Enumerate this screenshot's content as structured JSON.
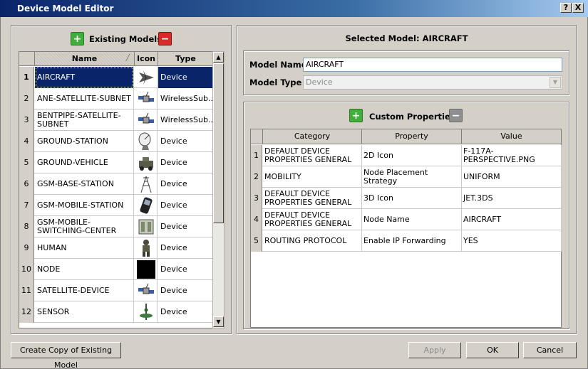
{
  "window": {
    "title": "Device Model Editor",
    "help_button": "?",
    "close_button": "X"
  },
  "left_panel": {
    "title": "Existing Models",
    "columns": [
      "Name",
      "Icon",
      "Type"
    ],
    "rows": [
      {
        "num": "1",
        "name": "AIRCRAFT",
        "icon": "jet-icon",
        "type": "Device",
        "selected": true
      },
      {
        "num": "2",
        "name": "ANE-SATELLITE-SUBNET",
        "icon": "satellite-icon",
        "type": "WirelessSub..."
      },
      {
        "num": "3",
        "name": "BENTPIPE-SATELLITE-SUBNET",
        "icon": "satellite-icon",
        "type": "WirelessSub..."
      },
      {
        "num": "4",
        "name": "GROUND-STATION",
        "icon": "dish-icon",
        "type": "Device"
      },
      {
        "num": "5",
        "name": "GROUND-VEHICLE",
        "icon": "vehicle-icon",
        "type": "Device"
      },
      {
        "num": "6",
        "name": "GSM-BASE-STATION",
        "icon": "tower-icon",
        "type": "Device"
      },
      {
        "num": "7",
        "name": "GSM-MOBILE-STATION",
        "icon": "phone-icon",
        "type": "Device"
      },
      {
        "num": "8",
        "name": "GSM-MOBILE-SWITCHING-CENTER",
        "icon": "switch-icon",
        "type": "Device"
      },
      {
        "num": "9",
        "name": "HUMAN",
        "icon": "soldier-icon",
        "type": "Device"
      },
      {
        "num": "10",
        "name": "NODE",
        "icon": "black-box-icon",
        "type": "Device"
      },
      {
        "num": "11",
        "name": "SATELLITE-DEVICE",
        "icon": "satellite-icon",
        "type": "Device"
      },
      {
        "num": "12",
        "name": "SENSOR",
        "icon": "sensor-icon",
        "type": "Device"
      }
    ],
    "copy_button": "Create Copy of Existing Model"
  },
  "right_panel": {
    "title": "Selected Model: AIRCRAFT",
    "model_name_label": "Model Name",
    "model_name_value": "AIRCRAFT",
    "model_type_label": "Model Type",
    "model_type_value": "Device",
    "custom_title": "Custom Properties",
    "columns": [
      "Category",
      "Property",
      "Value"
    ],
    "rows": [
      {
        "num": "1",
        "category": "DEFAULT DEVICE PROPERTIES GENERAL",
        "property": "2D Icon",
        "value": "F-117A-PERSPECTIVE.PNG"
      },
      {
        "num": "2",
        "category": "MOBILITY",
        "property": "Node Placement Strategy",
        "value": "UNIFORM"
      },
      {
        "num": "3",
        "category": "DEFAULT DEVICE PROPERTIES GENERAL",
        "property": "3D Icon",
        "value": "JET.3DS"
      },
      {
        "num": "4",
        "category": "DEFAULT DEVICE PROPERTIES GENERAL",
        "property": "Node Name",
        "value": "AIRCRAFT"
      },
      {
        "num": "5",
        "category": "ROUTING PROTOCOL",
        "property": "Enable IP Forwarding",
        "value": "YES"
      }
    ]
  },
  "footer": {
    "apply": "Apply",
    "ok": "OK",
    "cancel": "Cancel"
  },
  "colors": {
    "selection": "#0a246a",
    "add_green": "#3fae3a",
    "remove_red": "#d62b2b"
  }
}
